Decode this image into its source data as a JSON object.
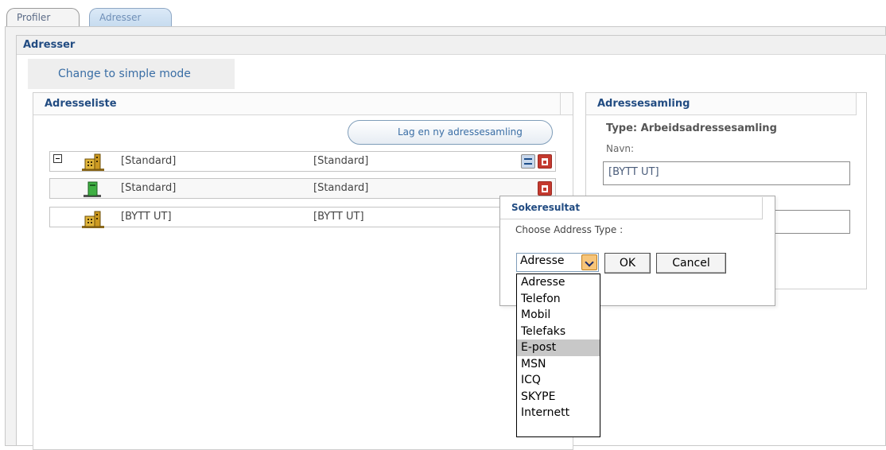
{
  "tabs": [
    {
      "label": "Profiler",
      "active": false
    },
    {
      "label": "Adresser",
      "active": true
    }
  ],
  "section_title": "Adresser",
  "mode_button": "Change to simple mode",
  "left_panel": {
    "title": "Adresseliste",
    "new_button": "Lag en ny adressesamling",
    "rows": [
      {
        "col1": "[Standard]",
        "col2": "[Standard]"
      },
      {
        "col1": "[Standard]",
        "col2": "[Standard]"
      },
      {
        "col1": "[BYTT UT]",
        "col2": "[BYTT UT]"
      }
    ]
  },
  "right_panel": {
    "title": "Adressesamling",
    "type_label": "Type: Arbeidsadressesamling",
    "name_label": "Navn:",
    "name_value": "[BYTT UT]",
    "desc_value": ""
  },
  "popup": {
    "title": "Sokeresultat",
    "prompt": "Choose Address Type :",
    "select_value": "Adresse",
    "ok_label": "OK",
    "cancel_label": "Cancel",
    "options": [
      "Adresse",
      "Telefon",
      "Mobil",
      "Telefaks",
      "E-post",
      "MSN",
      "ICQ",
      "SKYPE",
      "Internett"
    ],
    "highlighted_option": "E-post"
  },
  "colors": {
    "heading_blue": "#224c82",
    "link_blue": "#3a6ea5",
    "highlight_grey": "#c8c8c8"
  }
}
